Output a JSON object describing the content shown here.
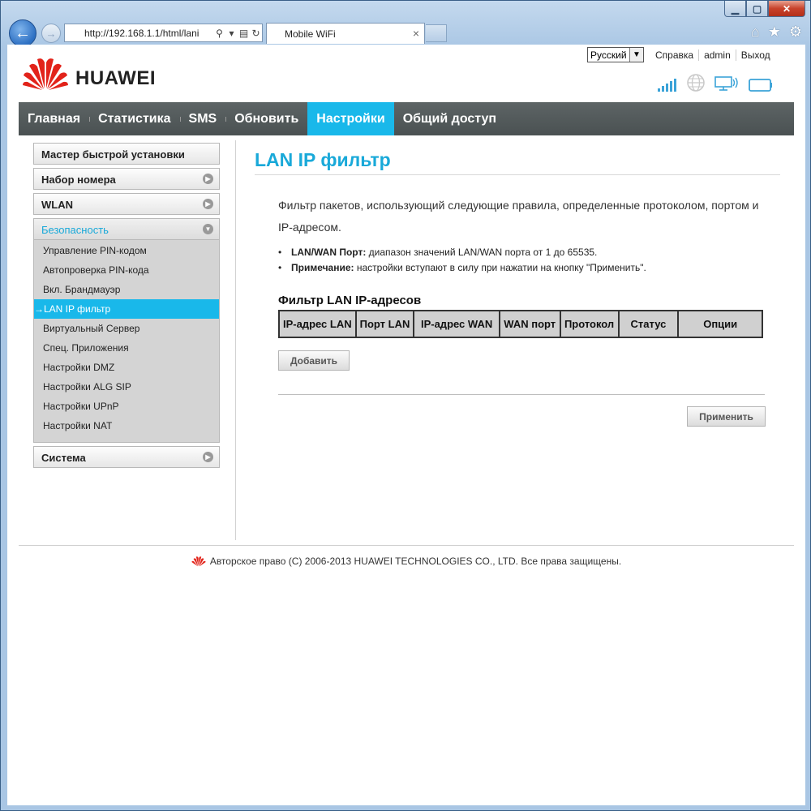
{
  "browser": {
    "address": "http://192.168.1.1/html/lani",
    "tab_title": "Mobile WiFi",
    "tab_close": "×"
  },
  "header": {
    "brand": "HUAWEI",
    "language": "Русский",
    "links": [
      "Справка",
      "admin",
      "Выход"
    ]
  },
  "nav": {
    "items": [
      "Главная",
      "Статистика",
      "SMS",
      "Обновить",
      "Настройки",
      "Общий доступ"
    ],
    "active": "Настройки"
  },
  "sidebar": {
    "quick_setup": "Мастер быстрой установки",
    "dialup": "Набор номера",
    "wlan": "WLAN",
    "security": "Безопасность",
    "security_items": [
      "Управление PIN-кодом",
      "Автопроверка PIN-кода",
      "Вкл. Брандмауэр",
      "LAN IP фильтр",
      "Виртуальный Сервер",
      "Спец. Приложения",
      "Настройки DMZ",
      "Настройки ALG SIP",
      "Настройки UPnP",
      "Настройки NAT"
    ],
    "active_item": "LAN IP фильтр",
    "active_prefix": "→",
    "system": "Система"
  },
  "content": {
    "title": "LAN IP фильтр",
    "intro": "Фильтр пакетов, использующий следующие правила, определенные протоколом, портом и IP-адресом.",
    "bullet1_label": "LAN/WAN Порт:",
    "bullet1_text": " диапазон значений LAN/WAN порта от 1 до 65535.",
    "bullet2_label": "Примечание:",
    "bullet2_text": " настройки вступают в силу при нажатии на кнопку \"Применить\".",
    "table_title": "Фильтр LAN IP-адресов",
    "columns": [
      "IP-адрес LAN",
      "Порт LAN",
      "IP-адрес WAN",
      "WAN порт",
      "Протокол",
      "Статус",
      "Опции"
    ],
    "add_button": "Добавить",
    "apply_button": "Применить"
  },
  "footer": {
    "copyright": "Авторское право (C) 2006-2013 HUAWEI TECHNOLOGIES CO., LTD. Все права защищены."
  },
  "colors": {
    "accent": "#19b8ea",
    "title": "#19a9d9",
    "nav_bg": "#545b5c",
    "brand_red": "#e2231a"
  }
}
